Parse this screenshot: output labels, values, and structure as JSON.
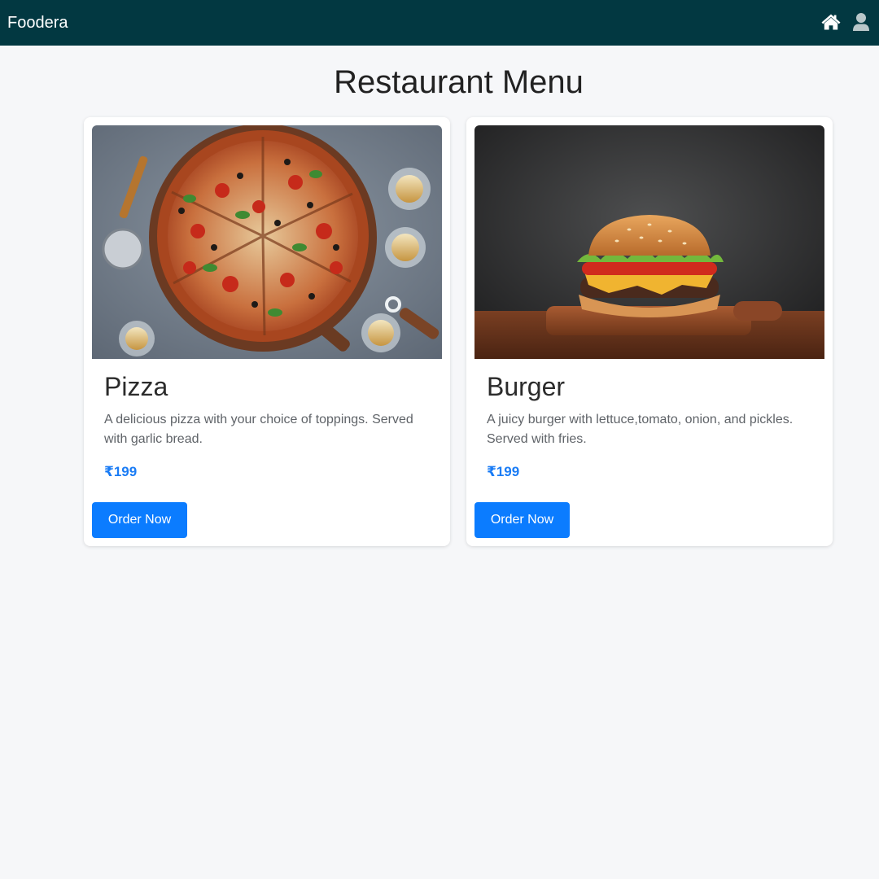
{
  "navbar": {
    "brand": "Foodera",
    "icons": [
      "home-icon",
      "user-icon"
    ],
    "background": "#023841"
  },
  "page": {
    "title": "Restaurant Menu"
  },
  "menu": {
    "items": [
      {
        "name": "Pizza",
        "description": "A delicious pizza with your choice of toppings. Served with garlic bread.",
        "price": "₹199",
        "button_label": "Order Now",
        "image": "pizza-photo"
      },
      {
        "name": "Burger",
        "description": "A juicy burger with lettuce,tomato, onion, and pickles. Served with fries.",
        "price": "₹199",
        "button_label": "Order Now",
        "image": "burger-photo"
      }
    ]
  },
  "colors": {
    "accent": "#0b7cff",
    "price": "#1a7cf5",
    "background": "#f6f7f9"
  }
}
